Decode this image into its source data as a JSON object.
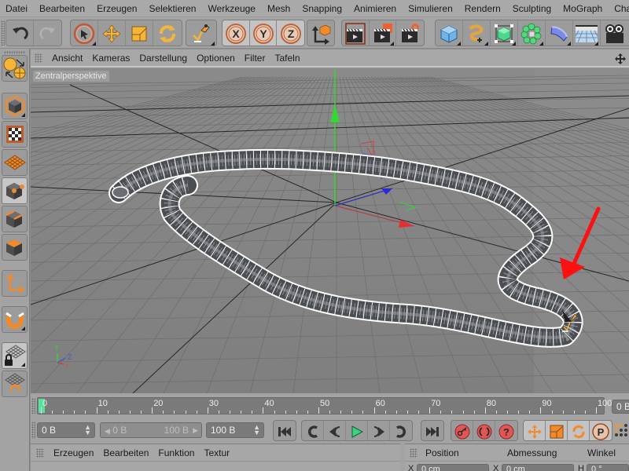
{
  "menubar": {
    "items": [
      "Datei",
      "Bearbeiten",
      "Erzeugen",
      "Selektieren",
      "Werkzeuge",
      "Mesh",
      "Snapping",
      "Animieren",
      "Simulieren",
      "Rendern",
      "Sculpting",
      "MoGraph",
      "Charak"
    ]
  },
  "toolbar": {
    "undo": "undo-icon",
    "redo": "redo-icon",
    "tools": [
      "live-selection",
      "move",
      "scale",
      "rotate",
      "recent-tools"
    ],
    "axis_x": "X",
    "axis_y": "Y",
    "axis_z": "Z",
    "coord_system": "world-coordinate-system",
    "render": [
      "render-view",
      "render-picture-viewer",
      "render-settings"
    ],
    "objects": [
      "cube",
      "spline-pen",
      "generator",
      "mograph-cloner",
      "deformer-bend",
      "environment-floor",
      "camera"
    ]
  },
  "leftbar": {
    "items": [
      "view-navigation",
      "model-mode",
      "texture-mode",
      "workplane-mode",
      "points-mode",
      "edges-mode",
      "polygons-mode",
      "axis-mode",
      "tweak-snap",
      "locked-workplane",
      "workplane-snapping"
    ]
  },
  "viewport": {
    "menu": [
      "Ansicht",
      "Kameras",
      "Darstellung",
      "Optionen",
      "Filter",
      "Tafeln"
    ],
    "label": "Zentralperspektive",
    "axis_labels": {
      "y": "Y",
      "z": "Z",
      "x": "X"
    },
    "colors": {
      "x_axis": "#e53030",
      "y_axis": "#36d636",
      "z_axis": "#2b2bd6",
      "annotation_arrow": "#ff1010",
      "wire": "#ffffff"
    }
  },
  "timeline": {
    "ticks": [
      0,
      10,
      20,
      30,
      40,
      50,
      60,
      70,
      80,
      90,
      100
    ],
    "current_frame": 0,
    "corner_field": "0 B",
    "playhead_color": "#56e29a"
  },
  "controls": {
    "start_field": "0 B",
    "range_min": "0 B",
    "range_max": "100 B",
    "end_field": "100 B",
    "play_color": "#3ad47a",
    "keyframe_color": "#e25555"
  },
  "bottom": {
    "material_menu": [
      "Erzeugen",
      "Bearbeiten",
      "Funktion",
      "Textur"
    ],
    "coord_headers": [
      "Position",
      "Abmessung",
      "Winkel"
    ],
    "coord_row": {
      "label_a": "X",
      "value_a": "0 cm",
      "label_b": "X",
      "value_b": "0 cm",
      "label_c": "H",
      "value_c": "0 °"
    }
  }
}
